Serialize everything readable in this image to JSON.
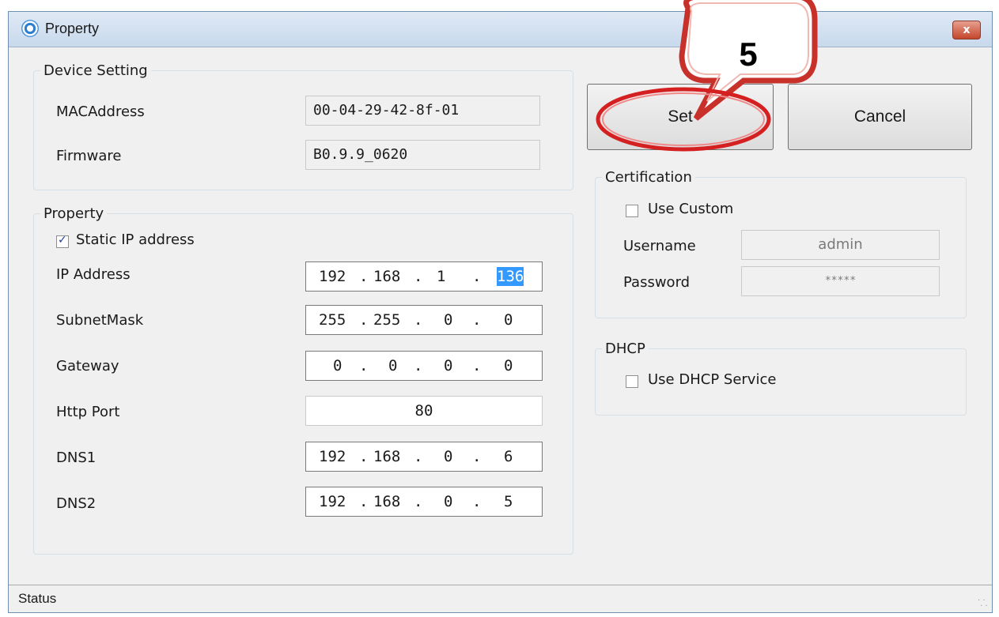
{
  "window": {
    "title": "Property",
    "close_label": "x"
  },
  "device_setting": {
    "legend": "Device Setting",
    "mac_label": "MACAddress",
    "mac_value": "00-04-29-42-8f-01",
    "firmware_label": "Firmware",
    "firmware_value": "B0.9.9_0620"
  },
  "property": {
    "legend": "Property",
    "static_ip_label": "Static IP address",
    "static_ip_checked": true,
    "ip_address": {
      "label": "IP Address",
      "octets": [
        "192",
        "168",
        "1",
        "136"
      ],
      "selected_octet": 3
    },
    "subnet_mask": {
      "label": "SubnetMask",
      "octets": [
        "255",
        "255",
        "0",
        "0"
      ]
    },
    "gateway": {
      "label": "Gateway",
      "octets": [
        "0",
        "0",
        "0",
        "0"
      ]
    },
    "http_port": {
      "label": "Http Port",
      "value": "80"
    },
    "dns1": {
      "label": "DNS1",
      "octets": [
        "192",
        "168",
        "0",
        "6"
      ]
    },
    "dns2": {
      "label": "DNS2",
      "octets": [
        "192",
        "168",
        "0",
        "5"
      ]
    }
  },
  "buttons": {
    "set_label": "Set",
    "cancel_label": "Cancel"
  },
  "certification": {
    "legend": "Certification",
    "use_custom_label": "Use Custom",
    "use_custom_checked": false,
    "username_label": "Username",
    "username_value": "admin",
    "password_label": "Password",
    "password_value": "*****"
  },
  "dhcp": {
    "legend": "DHCP",
    "use_dhcp_label": "Use DHCP Service",
    "use_dhcp_checked": false
  },
  "annotation": {
    "step_number": "5",
    "callout_color": "#d42020"
  },
  "status": {
    "text": "Status"
  }
}
